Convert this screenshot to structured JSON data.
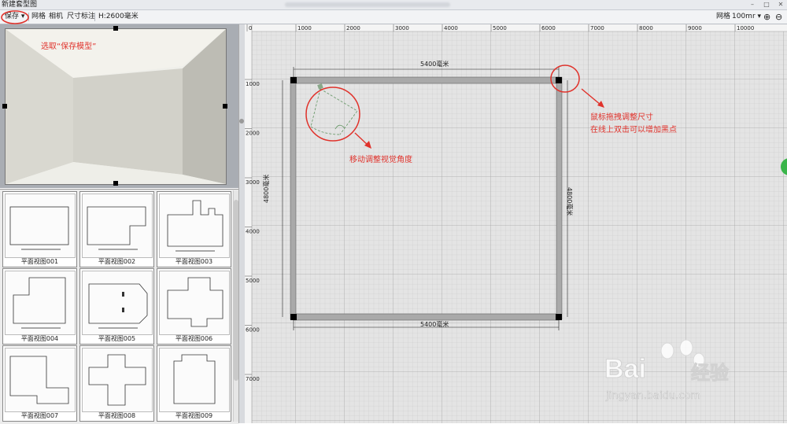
{
  "window": {
    "title": "新建套型图"
  },
  "toolbar": {
    "save_label": "保存",
    "grid_label": "网格",
    "camera_label": "相机",
    "dimension_label": "尺寸标注",
    "height_label": "H:2600毫米",
    "right_grid_label": "网格",
    "grid_size_value": "100mr"
  },
  "thumbnails": [
    {
      "caption": "平面视图001"
    },
    {
      "caption": "平面视图002"
    },
    {
      "caption": "平面视图003"
    },
    {
      "caption": "平面视图004"
    },
    {
      "caption": "平面视图005"
    },
    {
      "caption": "平面视图006"
    },
    {
      "caption": "平面视图007"
    },
    {
      "caption": "平面视图008"
    },
    {
      "caption": "平面视图009"
    }
  ],
  "ruler": {
    "x_ticks": [
      "0",
      "1000",
      "2000",
      "3000",
      "4000",
      "5000",
      "6000",
      "7000",
      "8000",
      "9000",
      "10000"
    ],
    "y_ticks": [
      "1000",
      "2000",
      "3000",
      "4000",
      "5000",
      "6000",
      "7000"
    ]
  },
  "room": {
    "top_dim": "5400毫米",
    "bottom_dim": "5400毫米",
    "left_dim": "4800毫米",
    "right_dim": "4800毫米"
  },
  "annotations": {
    "save_hint": "选取“保存模型”",
    "view_hint": "移动调整视觉角度",
    "resize_hint_1": "鼠标拖拽调整尺寸",
    "resize_hint_2": "在线上双击可以增加黑点"
  },
  "watermark": {
    "brand": "Bai",
    "brand2": "经验",
    "url": "jingyan.baidu.com"
  },
  "colors": {
    "annotation": "#e0322b",
    "grid_bg": "#e3e3e3",
    "wall": "#a8a8a8"
  }
}
